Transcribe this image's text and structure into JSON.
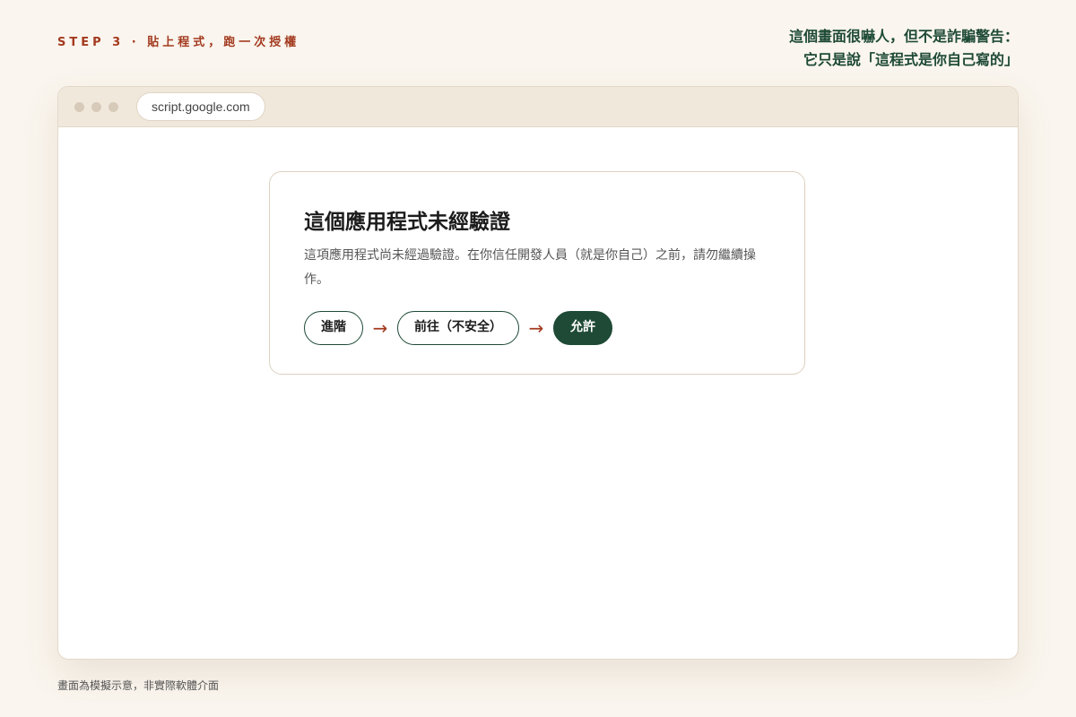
{
  "header": {
    "step_label": "STEP 3 · 貼上程式，跑一次授權",
    "note_line1": "這個畫面很嚇人，但不是詐騙警告：",
    "note_line2": "它只是說「這程式是你自己寫的」"
  },
  "browser": {
    "url": "script.google.com"
  },
  "dialog": {
    "title": "這個應用程式未經驗證",
    "body": "這項應用程式尚未經過驗證。在你信任開發人員（就是你自己）之前，請勿繼續操作。",
    "steps": {
      "advanced_label": "進階",
      "go_unsafe_label": "前往（不安全）",
      "allow_label": "允許",
      "arrow_icon": "right-arrow"
    }
  },
  "footer": {
    "note": "畫面為模擬示意，非實際軟體介面"
  },
  "colors": {
    "background": "#faf5ee",
    "accent_red": "#a33a1f",
    "accent_green": "#1e4a36"
  }
}
